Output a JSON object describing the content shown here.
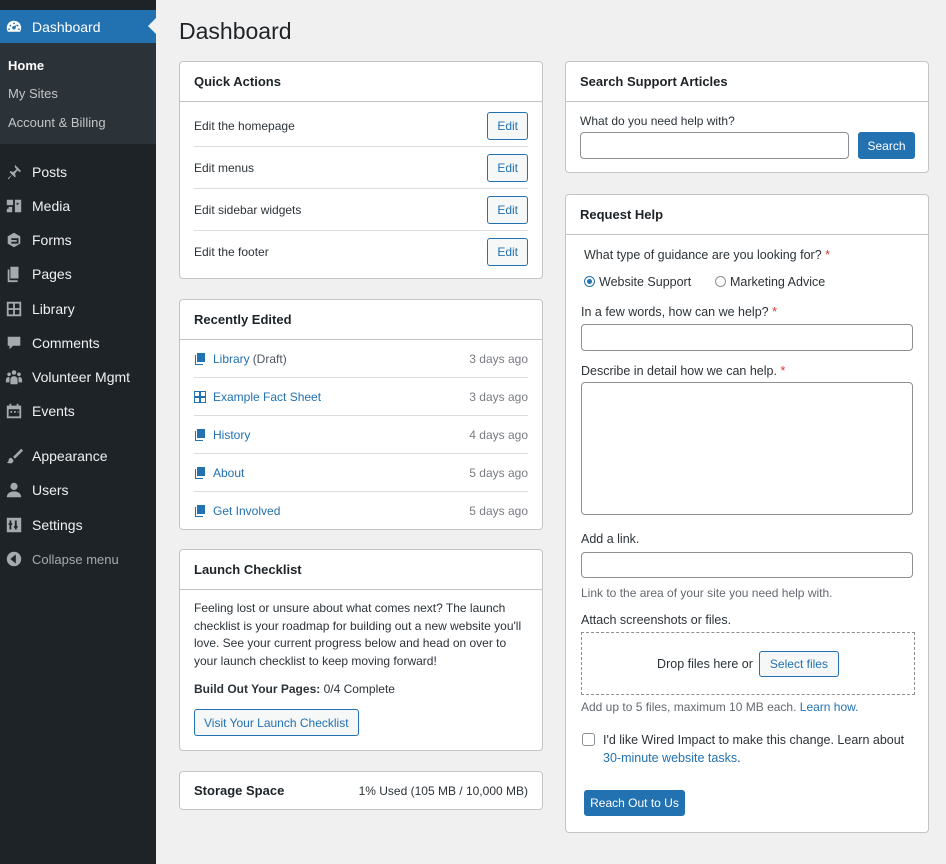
{
  "sidebar": {
    "dashboard": "Dashboard",
    "sub": [
      "Home",
      "My Sites",
      "Account & Billing"
    ],
    "items": [
      {
        "label": "Posts",
        "icon": "pin-icon"
      },
      {
        "label": "Media",
        "icon": "media-icon"
      },
      {
        "label": "Forms",
        "icon": "forms-icon"
      },
      {
        "label": "Pages",
        "icon": "pages-icon"
      },
      {
        "label": "Library",
        "icon": "library-icon"
      },
      {
        "label": "Comments",
        "icon": "comment-icon"
      },
      {
        "label": "Volunteer Mgmt",
        "icon": "volunteer-icon"
      },
      {
        "label": "Events",
        "icon": "calendar-icon"
      },
      {
        "label": "Appearance",
        "icon": "brush-icon"
      },
      {
        "label": "Users",
        "icon": "user-icon"
      },
      {
        "label": "Settings",
        "icon": "settings-icon"
      }
    ],
    "collapse": "Collapse menu"
  },
  "page": {
    "title": "Dashboard"
  },
  "quick_actions": {
    "title": "Quick Actions",
    "rows": [
      {
        "label": "Edit the homepage",
        "button": "Edit"
      },
      {
        "label": "Edit menus",
        "button": "Edit"
      },
      {
        "label": "Edit sidebar widgets",
        "button": "Edit"
      },
      {
        "label": "Edit the footer",
        "button": "Edit"
      }
    ]
  },
  "recently_edited": {
    "title": "Recently Edited",
    "rows": [
      {
        "label": "Library",
        "status": "(Draft)",
        "time": "3 days ago",
        "icon": "page-icon"
      },
      {
        "label": "Example Fact Sheet",
        "status": "",
        "time": "3 days ago",
        "icon": "grid-icon"
      },
      {
        "label": "History",
        "status": "",
        "time": "4 days ago",
        "icon": "page-icon"
      },
      {
        "label": "About",
        "status": "",
        "time": "5 days ago",
        "icon": "page-icon"
      },
      {
        "label": "Get Involved",
        "status": "",
        "time": "5 days ago",
        "icon": "page-icon"
      }
    ]
  },
  "launch_checklist": {
    "title": "Launch Checklist",
    "text": "Feeling lost or unsure about what comes next? The launch checklist is your roadmap for building out a new website you'll love. See your current progress below and head on over to your launch checklist to keep moving forward!",
    "progress_label": "Build Out Your Pages:",
    "progress_value": "0/4 Complete",
    "button": "Visit Your Launch Checklist"
  },
  "storage": {
    "title": "Storage Space",
    "value": "1% Used (105 MB / 10,000 MB)"
  },
  "search_support": {
    "title": "Search Support Articles",
    "label": "What do you need help with?",
    "value": "",
    "button": "Search"
  },
  "request_help": {
    "title": "Request Help",
    "q_type": "What type of guidance are you looking for?",
    "required": "*",
    "options": [
      "Website Support",
      "Marketing Advice"
    ],
    "selected": "Website Support",
    "q_short": "In a few words, how can we help?",
    "q_detail": "Describe in detail how we can help.",
    "q_link": "Add a link.",
    "link_help": "Link to the area of your site you need help with.",
    "q_attach": "Attach screenshots or files.",
    "drop_text": "Drop files here or",
    "select_files": "Select files",
    "attach_help": "Add up to 5 files, maximum 10 MB each.",
    "learn_how": "Learn how.",
    "consent_text": "I'd like Wired Impact to make this change. Learn about",
    "consent_link": "30-minute website tasks",
    "consent_end": ".",
    "submit": "Reach Out to Us"
  },
  "colors": {
    "accent": "#2271b1",
    "sidebar": "#1d2327",
    "background": "#f0f0f1",
    "required": "#d63638"
  }
}
